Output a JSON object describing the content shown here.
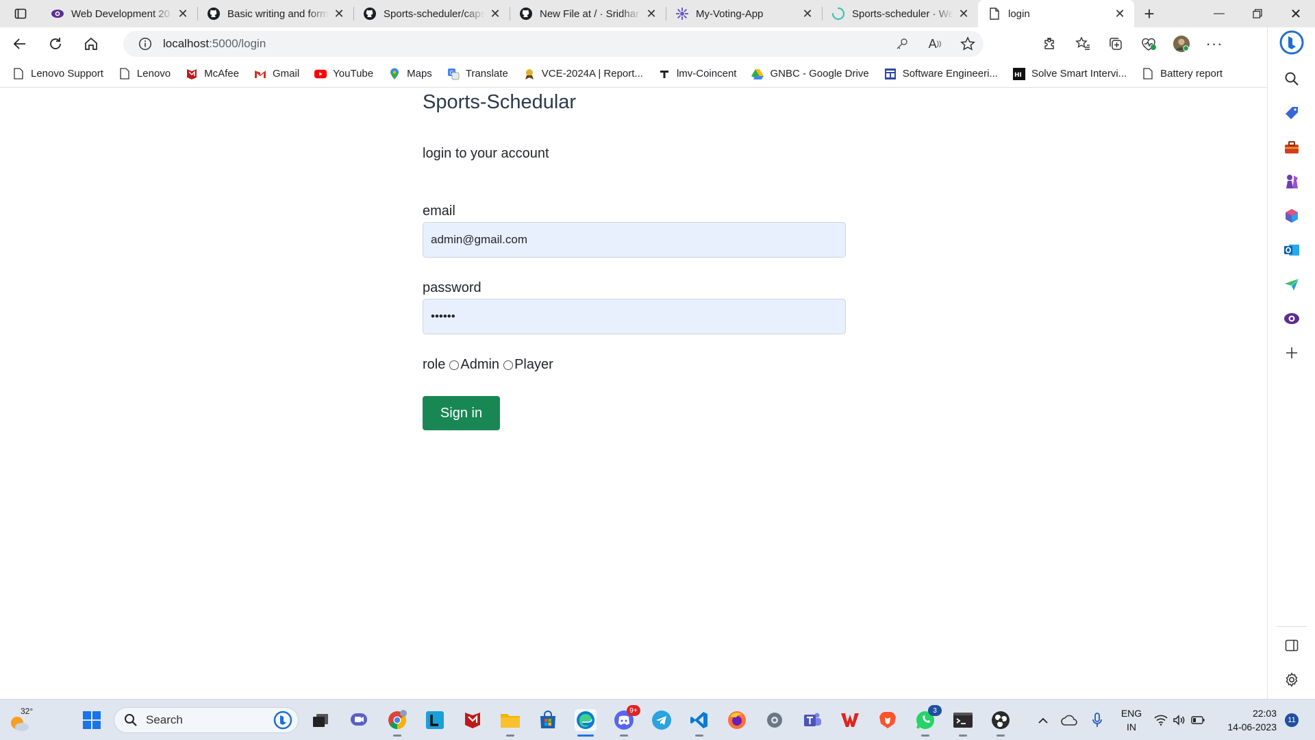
{
  "browser": {
    "tabs": [
      {
        "title": "Web Development 20",
        "icon": "eye-icon",
        "active": false
      },
      {
        "title": "Basic writing and form",
        "icon": "github-icon",
        "active": false
      },
      {
        "title": "Sports-scheduler/caps",
        "icon": "github-icon",
        "active": false
      },
      {
        "title": "New File at / · Sridhar",
        "icon": "github-icon",
        "active": false
      },
      {
        "title": "My-Voting-App",
        "icon": "gear-icon",
        "active": false
      },
      {
        "title": "Sports-scheduler · We",
        "icon": "spinner-icon",
        "active": false
      },
      {
        "title": "login",
        "icon": "page-icon",
        "active": true
      }
    ],
    "address": {
      "host": "localhost",
      "path": ":5000/login"
    },
    "bookmarks": [
      {
        "label": "Lenovo Support",
        "icon": "page-icon"
      },
      {
        "label": "Lenovo",
        "icon": "page-icon"
      },
      {
        "label": "McAfee",
        "icon": "mcafee-icon"
      },
      {
        "label": "Gmail",
        "icon": "gmail-icon"
      },
      {
        "label": "YouTube",
        "icon": "youtube-icon"
      },
      {
        "label": "Maps",
        "icon": "maps-icon"
      },
      {
        "label": "Translate",
        "icon": "translate-icon"
      },
      {
        "label": "VCE-2024A | Report...",
        "icon": "vce-icon"
      },
      {
        "label": "lmv-Coincent",
        "icon": "coincent-icon"
      },
      {
        "label": "GNBC - Google Drive",
        "icon": "drive-icon"
      },
      {
        "label": "Software Engineeri...",
        "icon": "se-icon"
      },
      {
        "label": "Solve Smart Intervi...",
        "icon": "solve-icon"
      },
      {
        "label": "Battery report",
        "icon": "page-icon"
      }
    ]
  },
  "page": {
    "brand": "Sports-Schedular",
    "subtitle": "login to your account",
    "email_label": "email",
    "email_value": "admin@gmail.com",
    "password_label": "password",
    "password_value": "••••••",
    "role_label": "role",
    "role_options": [
      "Admin",
      "Player"
    ],
    "signin_label": "Sign in"
  },
  "taskbar": {
    "temperature": "32°",
    "search_label": "Search",
    "lang_line1": "ENG",
    "lang_line2": "IN",
    "time": "22:03",
    "date": "14-06-2023",
    "notification_count": "11",
    "discord_badge": "9+",
    "whatsapp_badge": "3"
  },
  "colors": {
    "accent_green": "#198754",
    "input_bg": "#e8f0fe"
  }
}
